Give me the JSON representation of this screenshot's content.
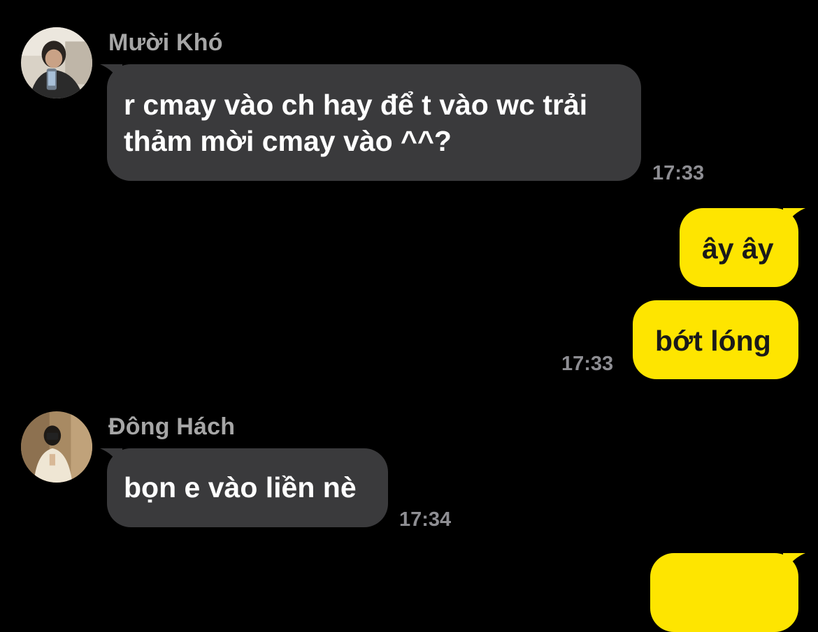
{
  "colors": {
    "background": "#000000",
    "incoming_bubble": "#3a3a3c",
    "outgoing_bubble": "#fee500",
    "sender_name": "#a6a6a6",
    "timestamp": "#8e8e93"
  },
  "messages": [
    {
      "direction": "incoming",
      "sender": "Mười Khó",
      "avatar_icon": "user-avatar-photo",
      "lines": [
        "r cmay vào ch hay để t vào wc trải",
        "thảm mời cmay vào ^^?"
      ],
      "time": "17:33"
    },
    {
      "direction": "outgoing",
      "text": "ây ây"
    },
    {
      "direction": "outgoing",
      "text": "bớt lóng",
      "time": "17:33"
    },
    {
      "direction": "incoming",
      "sender": "Đông Hách",
      "avatar_icon": "user-avatar-photo",
      "text": "bọn e vào liền nè",
      "time": "17:34"
    },
    {
      "direction": "outgoing",
      "text": ""
    }
  ]
}
